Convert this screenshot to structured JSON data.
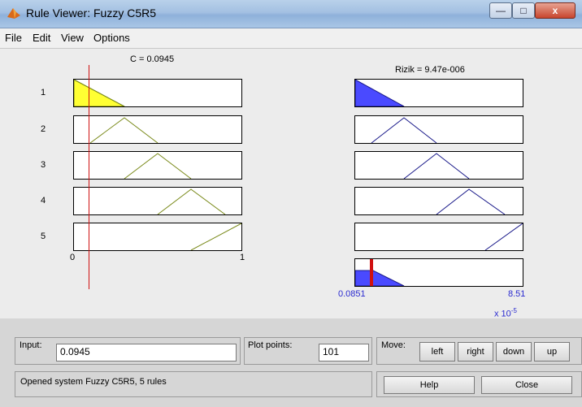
{
  "window": {
    "title": "Rule Viewer: Fuzzy C5R5",
    "controls": {
      "minimize": "—",
      "maximize": "□",
      "close": "x"
    }
  },
  "menu": [
    "File",
    "Edit",
    "View",
    "Options"
  ],
  "input_var": {
    "label": "C = 0.0945",
    "value": 0.0945,
    "range": [
      0,
      1
    ],
    "tick_min": "0",
    "tick_max": "1"
  },
  "output_var": {
    "label": "Rizik = 9.47e-006",
    "tick_min": "0.0851",
    "tick_max": "8.51",
    "scale": "x 10",
    "scale_exp": "-5"
  },
  "rules": [
    "1",
    "2",
    "3",
    "4",
    "5"
  ],
  "bottom": {
    "input_label": "Input:",
    "input_value": "0.0945",
    "plot_points_label": "Plot points:",
    "plot_points_value": "101",
    "move_label": "Move:",
    "move_buttons": [
      "left",
      "right",
      "down",
      "up"
    ],
    "status": "Opened system Fuzzy C5R5, 5 rules",
    "help": "Help",
    "close": "Close"
  },
  "colors": {
    "input_fill": "#ffff33",
    "output_fill": "#4a4aff",
    "input_curve": "#7a8a1a",
    "output_curve": "#1a1a8a",
    "indicator": "#d01010"
  }
}
